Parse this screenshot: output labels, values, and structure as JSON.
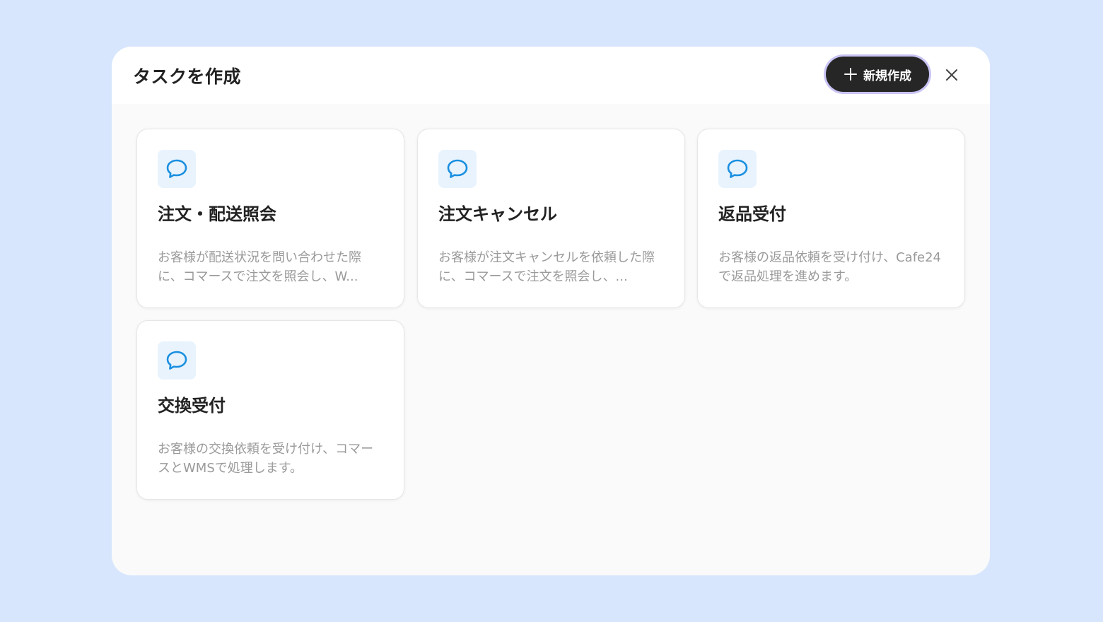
{
  "modal": {
    "title": "タスクを作成",
    "new_button_label": "新規作成",
    "close_icon": "close-icon",
    "new_icon": "plus-icon"
  },
  "colors": {
    "background": "#d7e6fd",
    "accent_icon": "#1a8fe0",
    "button_bg": "#262626",
    "button_ring": "#c9c4f5"
  },
  "cards": [
    {
      "icon": "chat-bubble-icon",
      "title": "注文・配送照会",
      "description": "お客様が配送状況を問い合わせた際に、コマースで注文を照会し、W..."
    },
    {
      "icon": "chat-bubble-icon",
      "title": "注文キャンセル",
      "description": "お客様が注文キャンセルを依頼した際に、コマースで注文を照会し、..."
    },
    {
      "icon": "chat-bubble-icon",
      "title": "返品受付",
      "description": "お客様の返品依頼を受け付け、Cafe24で返品処理を進めます。"
    },
    {
      "icon": "chat-bubble-icon",
      "title": "交換受付",
      "description": "お客様の交換依頼を受け付け、コマースとWMSで処理します。"
    }
  ]
}
